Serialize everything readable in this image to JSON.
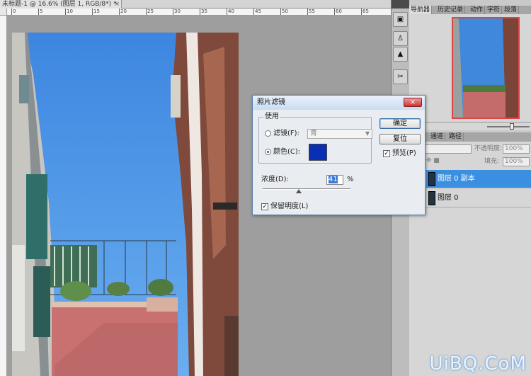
{
  "document": {
    "tab_title": "未标题-1 @ 16.6% (图层 1, RGB/8*) *",
    "close_glyph": "×",
    "ruler_h_labels": [
      "0",
      "5",
      "10",
      "15",
      "20",
      "25",
      "30",
      "35",
      "40",
      "45",
      "50",
      "55",
      "60",
      "65"
    ]
  },
  "panels": {
    "nav_tabs": [
      "导航器",
      "历史记录",
      "动作",
      "字符",
      "段落"
    ],
    "layer_tabs": [
      "通道",
      "路径"
    ],
    "opacity_label": "不透明度:",
    "opacity_value": "100%",
    "fill_label": "填充:",
    "fill_value": "100%",
    "layers": [
      {
        "name": "图层 0 副本",
        "selected": true
      },
      {
        "name": "图层 0",
        "selected": false
      }
    ]
  },
  "dialog": {
    "title": "照片滤镜",
    "close_glyph": "×",
    "use_group_label": "使用",
    "filter_label": "滤镜(F):",
    "filter_value": "青",
    "color_label": "颜色(C):",
    "color_value": "#0a2fb5",
    "density_label": "浓度(D):",
    "density_value": "41",
    "density_unit": "%",
    "density_level": 0.41,
    "preserve_label": "保留明度(L)",
    "preserve_checked": true,
    "ok_label": "确定",
    "reset_label": "复位",
    "preview_label": "预览(P)",
    "preview_checked": true,
    "check_glyph": "✓"
  },
  "watermark": "UiBQ.CoM",
  "colors": {
    "sky": "#4a90e0",
    "selection": "#3b8fe0",
    "dialog_border": "#5a7fa8"
  }
}
